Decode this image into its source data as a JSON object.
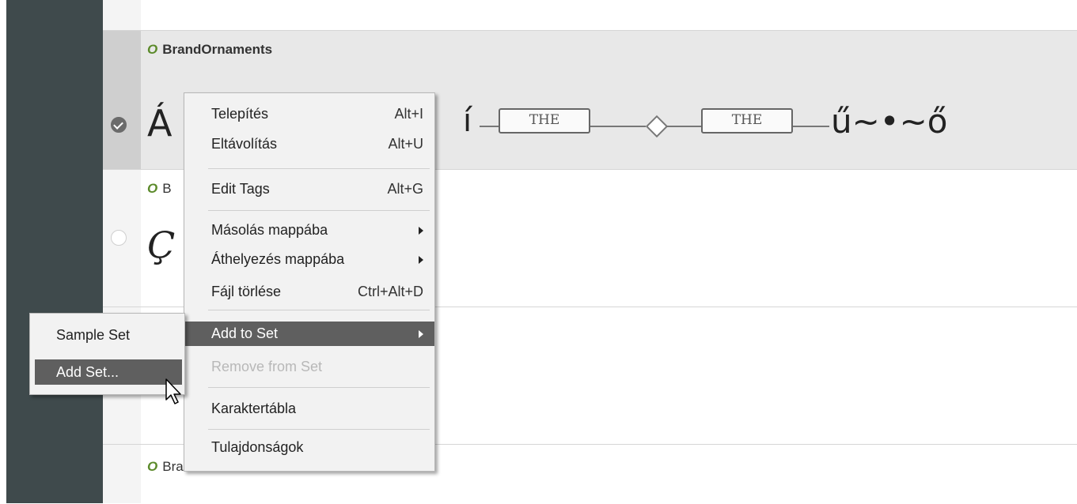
{
  "font_list": {
    "rows": [
      {
        "name": "BrandOrnaments",
        "selected": true,
        "sample_text_left": "Á",
        "sample_text_mid": "í",
        "banner_text": "THE",
        "sample_text_right": "ű~•~ő"
      },
      {
        "name": "B",
        "selected": false,
        "sample_text_left": "Ç"
      },
      {
        "name": "",
        "selected": false
      },
      {
        "name": "BrandShadeSoloStandard",
        "selected": false
      }
    ],
    "name_icon": "O"
  },
  "context_menu": {
    "items": [
      {
        "label": "Telepítés",
        "shortcut": "Alt+I"
      },
      {
        "label": "Eltávolítás",
        "shortcut": "Alt+U"
      },
      {
        "label": "Edit Tags",
        "shortcut": "Alt+G"
      },
      {
        "label": "Másolás mappába",
        "shortcut": ""
      },
      {
        "label": "Áthelyezés mappába",
        "shortcut": ""
      },
      {
        "label": "Fájl törlése",
        "shortcut": "Ctrl+Alt+D"
      },
      {
        "label": "Add to Set",
        "shortcut": ""
      },
      {
        "label": "Remove from Set",
        "shortcut": ""
      },
      {
        "label": "Karaktertábla",
        "shortcut": ""
      },
      {
        "label": "Tulajdonságok",
        "shortcut": ""
      }
    ]
  },
  "submenu": {
    "items": [
      {
        "label": "Sample Set"
      },
      {
        "label": "Add Set..."
      }
    ]
  },
  "colors": {
    "sidebar": "#3f4a4c",
    "menu_highlight": "#5f5f5f",
    "icon_green": "#5b8a2a"
  },
  "icons": {
    "checkmark": "check-icon",
    "submenu_arrow": "triangle-right-icon",
    "cursor": "mouse-pointer-icon"
  }
}
